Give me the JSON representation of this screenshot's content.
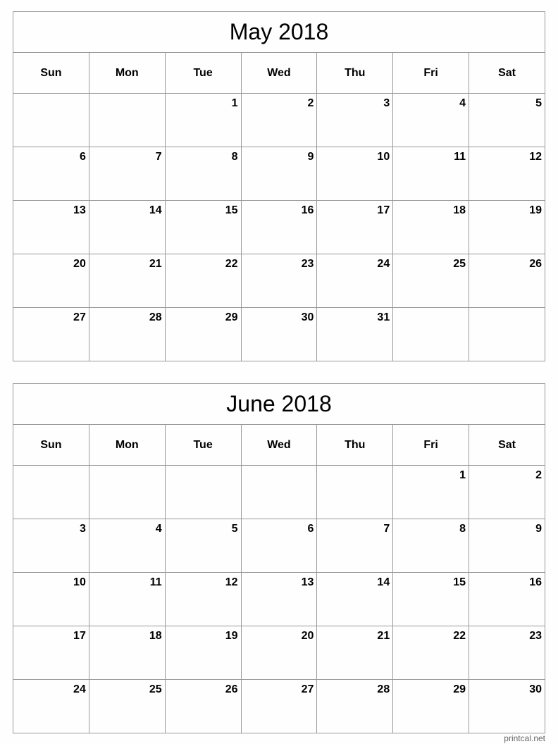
{
  "weekdays": [
    "Sun",
    "Mon",
    "Tue",
    "Wed",
    "Thu",
    "Fri",
    "Sat"
  ],
  "calendars": [
    {
      "title": "May 2018",
      "weeks": [
        [
          "",
          "",
          "1",
          "2",
          "3",
          "4",
          "5"
        ],
        [
          "6",
          "7",
          "8",
          "9",
          "10",
          "11",
          "12"
        ],
        [
          "13",
          "14",
          "15",
          "16",
          "17",
          "18",
          "19"
        ],
        [
          "20",
          "21",
          "22",
          "23",
          "24",
          "25",
          "26"
        ],
        [
          "27",
          "28",
          "29",
          "30",
          "31",
          "",
          ""
        ]
      ]
    },
    {
      "title": "June 2018",
      "weeks": [
        [
          "",
          "",
          "",
          "",
          "",
          "1",
          "2"
        ],
        [
          "3",
          "4",
          "5",
          "6",
          "7",
          "8",
          "9"
        ],
        [
          "10",
          "11",
          "12",
          "13",
          "14",
          "15",
          "16"
        ],
        [
          "17",
          "18",
          "19",
          "20",
          "21",
          "22",
          "23"
        ],
        [
          "24",
          "25",
          "26",
          "27",
          "28",
          "29",
          "30"
        ]
      ]
    }
  ],
  "footer": "printcal.net"
}
